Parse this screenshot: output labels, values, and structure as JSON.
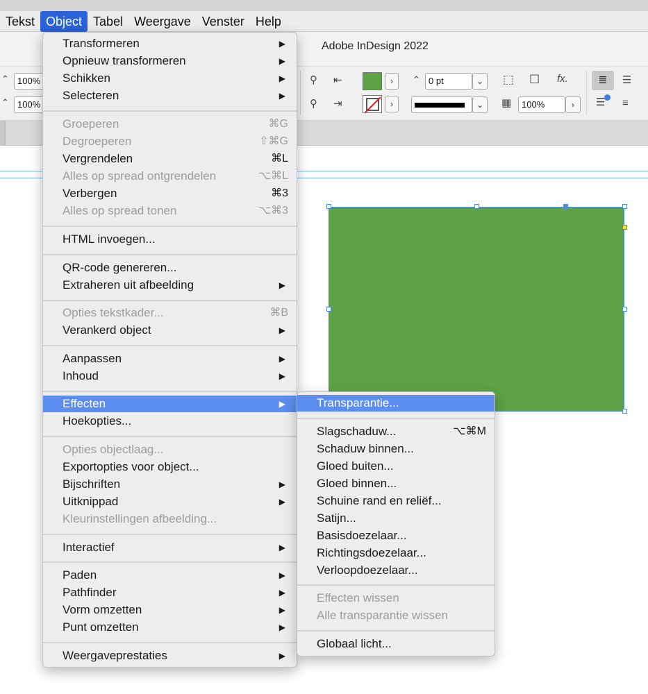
{
  "menubar": {
    "items": [
      {
        "label": "Tekst"
      },
      {
        "label": "Object"
      },
      {
        "label": "Tabel"
      },
      {
        "label": "Weergave"
      },
      {
        "label": "Venster"
      },
      {
        "label": "Help"
      }
    ]
  },
  "app": {
    "title": "Adobe InDesign 2022"
  },
  "controls": {
    "scale_x": "100%",
    "scale_y": "100%",
    "stroke_weight": "0 pt",
    "opacity": "100%",
    "fill_color": "#5da244",
    "fx_label": "fx."
  },
  "canvas": {
    "rect_color": "#5da244"
  },
  "object_menu": {
    "items": [
      {
        "label": "Transformeren",
        "shortcut": "",
        "submenu": true,
        "enabled": true
      },
      {
        "label": "Opnieuw transformeren",
        "shortcut": "",
        "submenu": true,
        "enabled": true
      },
      {
        "label": "Schikken",
        "shortcut": "",
        "submenu": true,
        "enabled": true
      },
      {
        "label": "Selecteren",
        "shortcut": "",
        "submenu": true,
        "enabled": true
      },
      {
        "label": "Groeperen",
        "shortcut": "⌘G",
        "submenu": false,
        "enabled": false
      },
      {
        "label": "Degroeperen",
        "shortcut": "⇧⌘G",
        "submenu": false,
        "enabled": false
      },
      {
        "label": "Vergrendelen",
        "shortcut": "⌘L",
        "submenu": false,
        "enabled": true
      },
      {
        "label": "Alles op spread ontgrendelen",
        "shortcut": "⌥⌘L",
        "submenu": false,
        "enabled": false
      },
      {
        "label": "Verbergen",
        "shortcut": "⌘3",
        "submenu": false,
        "enabled": true
      },
      {
        "label": "Alles op spread tonen",
        "shortcut": "⌥⌘3",
        "submenu": false,
        "enabled": false
      },
      {
        "label": "HTML invoegen...",
        "shortcut": "",
        "submenu": false,
        "enabled": true
      },
      {
        "label": "QR-code genereren...",
        "shortcut": "",
        "submenu": false,
        "enabled": true
      },
      {
        "label": "Extraheren uit afbeelding",
        "shortcut": "",
        "submenu": true,
        "enabled": true
      },
      {
        "label": "Opties tekstkader...",
        "shortcut": "⌘B",
        "submenu": false,
        "enabled": false
      },
      {
        "label": "Verankerd object",
        "shortcut": "",
        "submenu": true,
        "enabled": true
      },
      {
        "label": "Aanpassen",
        "shortcut": "",
        "submenu": true,
        "enabled": true
      },
      {
        "label": "Inhoud",
        "shortcut": "",
        "submenu": true,
        "enabled": true
      },
      {
        "label": "Effecten",
        "shortcut": "",
        "submenu": true,
        "enabled": true,
        "highlighted": true
      },
      {
        "label": "Hoekopties...",
        "shortcut": "",
        "submenu": false,
        "enabled": true
      },
      {
        "label": "Opties objectlaag...",
        "shortcut": "",
        "submenu": false,
        "enabled": false
      },
      {
        "label": "Exportopties voor object...",
        "shortcut": "",
        "submenu": false,
        "enabled": true
      },
      {
        "label": "Bijschriften",
        "shortcut": "",
        "submenu": true,
        "enabled": true
      },
      {
        "label": "Uitknippad",
        "shortcut": "",
        "submenu": true,
        "enabled": true
      },
      {
        "label": "Kleurinstellingen afbeelding...",
        "shortcut": "",
        "submenu": false,
        "enabled": false
      },
      {
        "label": "Interactief",
        "shortcut": "",
        "submenu": true,
        "enabled": true
      },
      {
        "label": "Paden",
        "shortcut": "",
        "submenu": true,
        "enabled": true
      },
      {
        "label": "Pathfinder",
        "shortcut": "",
        "submenu": true,
        "enabled": true
      },
      {
        "label": "Vorm omzetten",
        "shortcut": "",
        "submenu": true,
        "enabled": true
      },
      {
        "label": "Punt omzetten",
        "shortcut": "",
        "submenu": true,
        "enabled": true
      },
      {
        "label": "Weergaveprestaties",
        "shortcut": "",
        "submenu": true,
        "enabled": true
      }
    ]
  },
  "effects_menu": {
    "items": [
      {
        "label": "Transparantie...",
        "shortcut": "",
        "enabled": true,
        "highlighted": true
      },
      {
        "label": "Slagschaduw...",
        "shortcut": "⌥⌘M",
        "enabled": true
      },
      {
        "label": "Schaduw binnen...",
        "shortcut": "",
        "enabled": true
      },
      {
        "label": "Gloed buiten...",
        "shortcut": "",
        "enabled": true
      },
      {
        "label": "Gloed binnen...",
        "shortcut": "",
        "enabled": true
      },
      {
        "label": "Schuine rand en reliëf...",
        "shortcut": "",
        "enabled": true
      },
      {
        "label": "Satijn...",
        "shortcut": "",
        "enabled": true
      },
      {
        "label": "Basisdoezelaar...",
        "shortcut": "",
        "enabled": true
      },
      {
        "label": "Richtingsdoezelaar...",
        "shortcut": "",
        "enabled": true
      },
      {
        "label": "Verloopdoezelaar...",
        "shortcut": "",
        "enabled": true
      },
      {
        "label": "Effecten wissen",
        "shortcut": "",
        "enabled": false
      },
      {
        "label": "Alle transparantie wissen",
        "shortcut": "",
        "enabled": false
      },
      {
        "label": "Globaal licht...",
        "shortcut": "",
        "enabled": true
      }
    ]
  },
  "colors": {
    "accent": "#2b62d9",
    "menu_highlight": "#5b8def"
  }
}
